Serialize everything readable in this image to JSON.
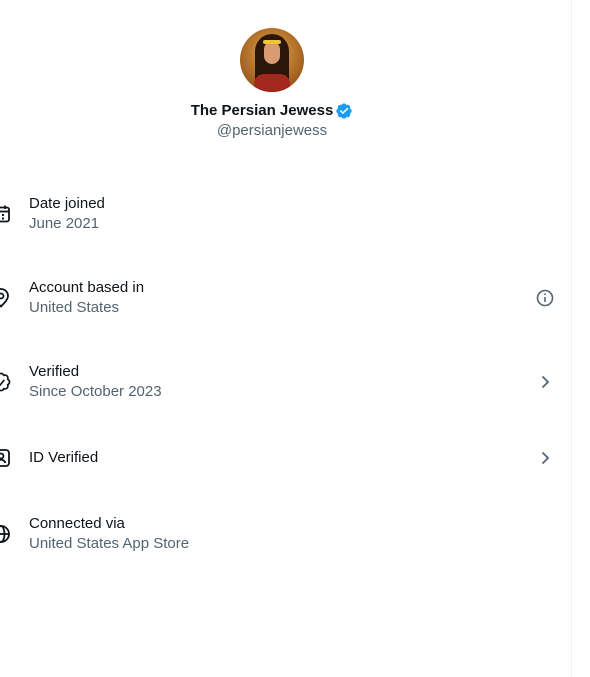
{
  "profile": {
    "display_name": "The Persian Jewess",
    "handle": "@persianjewess",
    "verified_badge_icon": "verified-badge-icon",
    "accent_color": "#1d9bf0"
  },
  "rows": [
    {
      "icon": "calendar-icon",
      "label": "Date joined",
      "value": "June 2021",
      "trailing": null
    },
    {
      "icon": "location-pin-icon",
      "label": "Account based in",
      "value": "United States",
      "trailing": "info-icon"
    },
    {
      "icon": "verified-seal-icon",
      "label": "Verified",
      "value": "Since October 2023",
      "trailing": "chevron-right-icon"
    },
    {
      "icon": "id-card-icon",
      "label": "ID Verified",
      "value": "",
      "trailing": "chevron-right-icon"
    },
    {
      "icon": "globe-icon",
      "label": "Connected via",
      "value": "United States App Store",
      "trailing": null
    }
  ],
  "colors": {
    "primary_text": "#0f1419",
    "secondary_text": "#536471",
    "divider": "#eff3f4"
  }
}
